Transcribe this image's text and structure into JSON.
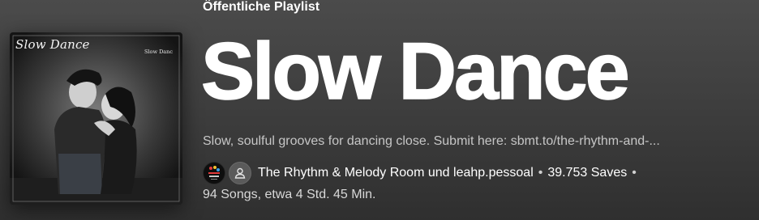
{
  "header": {
    "type_label": "Öffentliche Playlist",
    "title": "Slow Dance",
    "description": "Slow, soulful grooves for dancing close. Submit here: sbmt.to/the-rhythm-and-...",
    "owners": {
      "first": "The Rhythm & Melody Room",
      "conjunction": "und",
      "second": "leahp.pessoal"
    },
    "separator": "•",
    "saves": "39.753 Saves",
    "songs_duration": "94 Songs, etwa 4 Std. 45 Min."
  },
  "cover": {
    "title": "Slow Dance",
    "subtitle": "Slow Danc"
  },
  "icons": {
    "owner_avatar": "rhythm-melody-room-logo",
    "user_avatar": "user-silhouette-icon"
  },
  "colors": {
    "background_top": "#4b4b4b",
    "background_bottom": "#2f2f2f",
    "title": "#ffffff",
    "description": "#c6c6c6"
  }
}
